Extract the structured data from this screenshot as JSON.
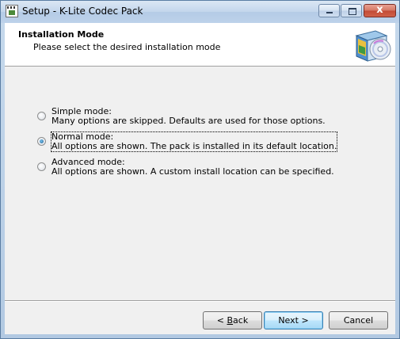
{
  "window": {
    "title": "Setup - K-Lite Codec Pack",
    "close_glyph": "x"
  },
  "header": {
    "title": "Installation Mode",
    "subtitle": "Please select the desired installation mode"
  },
  "options": [
    {
      "label": "Simple mode:",
      "description": "Many options are skipped. Defaults are used for those options.",
      "checked": false
    },
    {
      "label": "Normal mode:",
      "description": "All options are shown. The pack is installed in its default location.",
      "checked": true
    },
    {
      "label": "Advanced mode:",
      "description": "All options are shown. A custom install location can be specified.",
      "checked": false
    }
  ],
  "buttons": {
    "back_prefix": "< ",
    "back_mnemonic": "B",
    "back_rest": "ack",
    "next": "Next >",
    "cancel": "Cancel"
  },
  "icons": {
    "app": "setup-app-icon",
    "header": "software-box-cd-icon"
  }
}
